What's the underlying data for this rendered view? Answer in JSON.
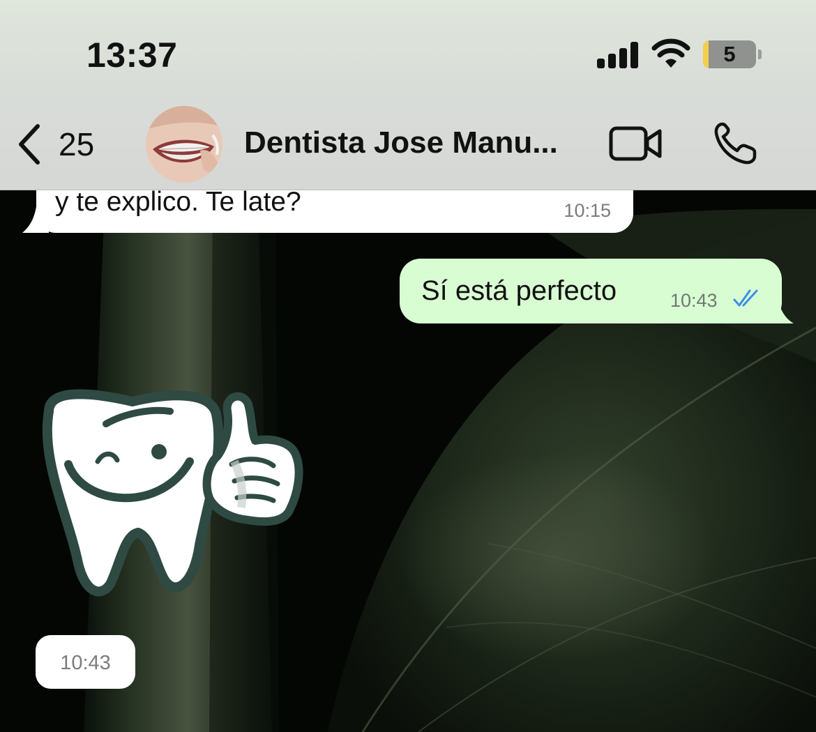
{
  "status_bar": {
    "time": "13:37",
    "battery_level": "5",
    "signal_bars": 4,
    "icons": [
      "signal-icon",
      "wifi-icon",
      "battery-icon"
    ]
  },
  "header": {
    "back_count": "25",
    "contact_name": "Dentista Jose Manu...",
    "icons": [
      "chevron-left-icon",
      "video-call-icon",
      "phone-icon"
    ]
  },
  "messages": [
    {
      "direction": "incoming",
      "type": "text",
      "text": "y te explico. Te late?",
      "time": "10:15"
    },
    {
      "direction": "outgoing",
      "type": "text",
      "text": "Sí está perfecto",
      "time": "10:43",
      "status": "read"
    },
    {
      "direction": "incoming",
      "type": "sticker",
      "sticker": "tooth-thumbs-up-sticker",
      "time": "10:43"
    }
  ],
  "colors": {
    "outgoing_bubble": "#d9fdd3",
    "incoming_bubble": "#ffffff",
    "read_ticks": "#3a8ee6",
    "sticker_outline": "#2e4a43"
  }
}
